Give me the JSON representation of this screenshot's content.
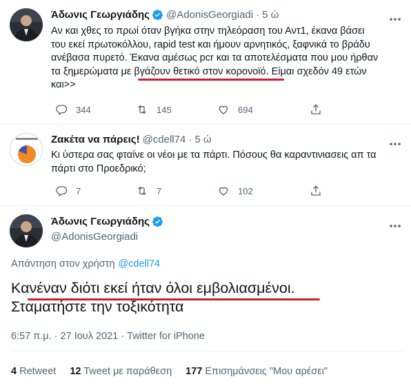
{
  "colors": {
    "accent": "#1d9bf0",
    "muted": "#536471",
    "annotation": "#c8202a"
  },
  "tweet1": {
    "name": "Άδωνις Γεωργιάδης",
    "handle": "@AdonisGeorgiadi",
    "time": "5 ώ",
    "lines": [
      "Αν και χθες το πρωί όταν βγήκα στην τηλεόραση του Αντ1, έκανα βάσει",
      "του εκεί πρωτοκόλλου, rapid test και ήμουν αρνητικός, ξαφνικά το βράδυ",
      "ανέβασα πυρετό. Έκανα αμέσως pcr και τα αποτελέσματα που μου ήρθαν",
      "τα ξημερώματα με βγάζουν θετικό στον κορονοϊό. Είμαι σχεδόν 49 ετών",
      "και>>"
    ],
    "replies": "344",
    "retweets": "145",
    "likes": "694"
  },
  "tweet2": {
    "name": "Ζακέτα να πάρεις!",
    "handle": "@cdell74",
    "time": "5 ώ",
    "lines": [
      "Κι ύστερα σας φταίνε οι νέοι με τα πάρτι. Πόσους θα καραντινιασεις απ τα",
      "πάρτι στο Προεδρικό;"
    ],
    "replies": "7",
    "retweets": "7",
    "likes": "102"
  },
  "tweet3": {
    "name": "Άδωνις Γεωργιάδης",
    "handle": "@AdonisGeorgiadi",
    "reply_prefix": "Απάντηση στον χρήστη",
    "reply_to": "@cdell74",
    "lines": [
      "Κανέναν διότι εκεί ήταν όλοι εμβολιασμένοι.",
      "Σταματήστε την τοξικότητα"
    ],
    "timestamp": "6:57 π.μ. · 27 Ιουλ 2021 · Twitter for iPhone",
    "stats": {
      "retweets_count": "4",
      "retweets_label": "Retweet",
      "quotes_count": "12",
      "quotes_label": "Tweet με παράθεση",
      "likes_count": "177",
      "likes_label": "Επισημάνσεις \"Μου αρέσει\""
    }
  }
}
